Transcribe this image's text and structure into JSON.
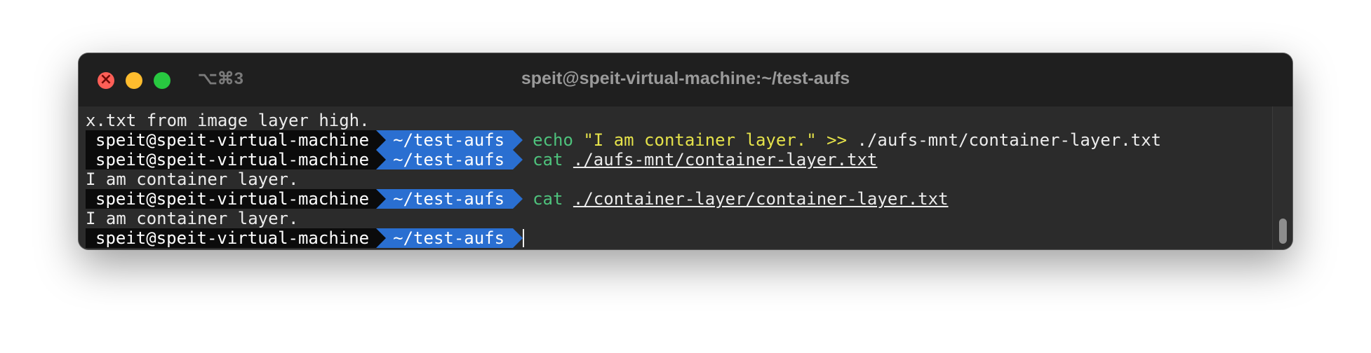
{
  "window": {
    "title": "speit@speit-virtual-machine:~/test-aufs",
    "tab_shortcut": "⌥⌘3"
  },
  "terminal": {
    "lines": [
      {
        "text": "x.txt from image layer high."
      },
      {
        "user": "speit@speit-virtual-machine",
        "dir": "~/test-aufs",
        "cmd": "echo",
        "arg1": "\"I am container layer.\"",
        "op": ">>",
        "arg2": "./aufs-mnt/container-layer.txt"
      },
      {
        "user": "speit@speit-virtual-machine",
        "dir": "~/test-aufs",
        "cmd": "cat",
        "arg": "./aufs-mnt/container-layer.txt"
      },
      {
        "text": "I am container layer."
      },
      {
        "user": "speit@speit-virtual-machine",
        "dir": "~/test-aufs",
        "cmd": "cat",
        "arg": "./container-layer/container-layer.txt"
      },
      {
        "text": "I am container layer."
      },
      {
        "user": "speit@speit-virtual-machine",
        "dir": "~/test-aufs"
      }
    ]
  },
  "colors": {
    "window_bg": "#2b2b2b",
    "titlebar_bg": "#1f1f1f",
    "prompt_user_bg": "#0b0b0b",
    "prompt_dir_bg": "#2a6fd1",
    "command": "#4ec27c",
    "string": "#e5e24a",
    "close": "#fe5f57",
    "minimize": "#febc2e",
    "zoom": "#28c840"
  }
}
